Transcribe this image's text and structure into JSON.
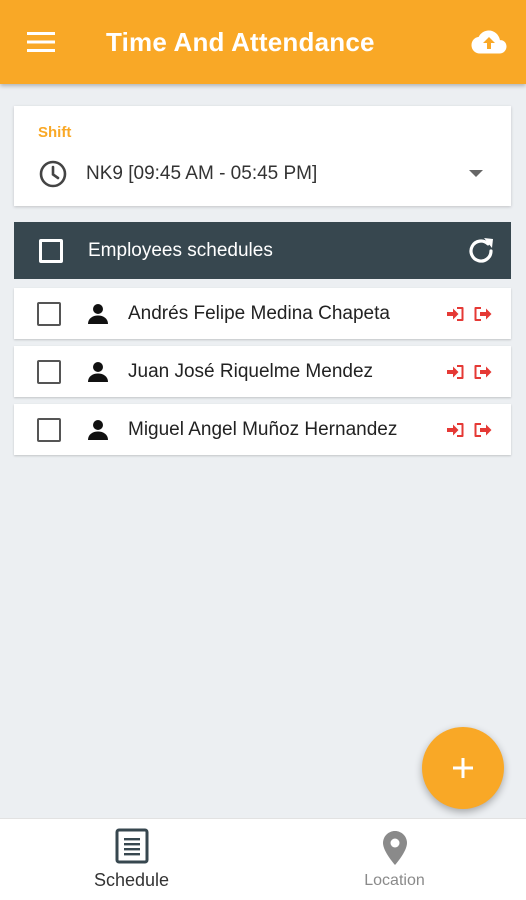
{
  "appbar": {
    "title": "Time And Attendance",
    "menu_icon": "menu-icon",
    "upload_icon": "cloud-upload-icon",
    "color": "#f9a826"
  },
  "shift": {
    "label": "Shift",
    "selected": "NK9 [09:45 AM - 05:45 PM]"
  },
  "schedules": {
    "header_label": "Employees schedules",
    "header_color": "#37474f",
    "employees": [
      {
        "name": "Andrés Felipe Medina Chapeta"
      },
      {
        "name": "Juan José Riquelme Mendez"
      },
      {
        "name": "Miguel Angel Muñoz Hernandez"
      }
    ],
    "checkin_color": "#e53935"
  },
  "fab": {
    "icon": "plus-icon"
  },
  "bottom_nav": {
    "tabs": [
      {
        "label": "Schedule",
        "icon": "schedule-icon",
        "active": true
      },
      {
        "label": "Location",
        "icon": "location-pin-icon",
        "active": false
      }
    ]
  }
}
